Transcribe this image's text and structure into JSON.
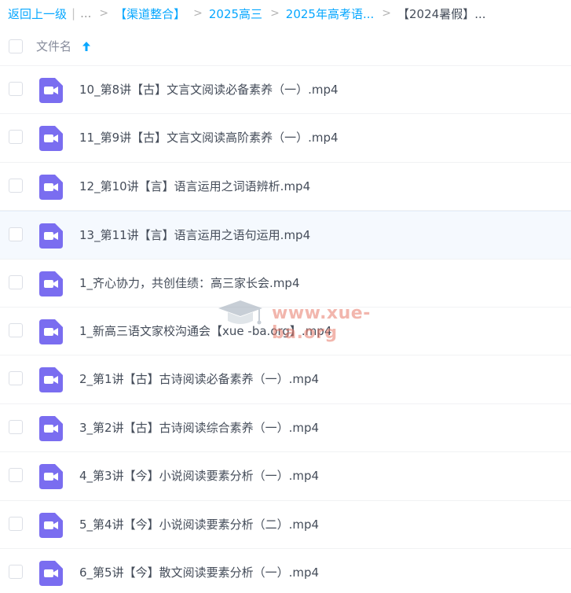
{
  "breadcrumb": {
    "back_label": "返回上一级",
    "separator": "|",
    "ellipsis": "...",
    "items": [
      "【渠道整合】",
      "2025高三",
      "2025年高考语...",
      "【2024暑假】..."
    ],
    "arrow": ">"
  },
  "header": {
    "column_label": "文件名",
    "sort_icon": "arrow-up-icon"
  },
  "files": [
    {
      "name": "10_第8讲【古】文言文阅读必备素养（一）.mp4",
      "icon": "video-file-icon"
    },
    {
      "name": "11_第9讲【古】文言文阅读高阶素养（一）.mp4",
      "icon": "video-file-icon"
    },
    {
      "name": "12_第10讲【言】语言运用之词语辨析.mp4",
      "icon": "video-file-icon"
    },
    {
      "name": "13_第11讲【言】语言运用之语句运用.mp4",
      "icon": "video-file-icon",
      "hovered": true
    },
    {
      "name": "1_齐心协力，共创佳绩：高三家长会.mp4",
      "icon": "video-file-icon"
    },
    {
      "name": "1_新高三语文家校沟通会【xue -ba.org】.mp4",
      "icon": "video-file-icon"
    },
    {
      "name": "2_第1讲【古】古诗阅读必备素养（一）.mp4",
      "icon": "video-file-icon"
    },
    {
      "name": "3_第2讲【古】古诗阅读综合素养（一）.mp4",
      "icon": "video-file-icon"
    },
    {
      "name": "4_第3讲【今】小说阅读要素分析（一）.mp4",
      "icon": "video-file-icon"
    },
    {
      "name": "5_第4讲【今】小说阅读要素分析（二）.mp4",
      "icon": "video-file-icon"
    },
    {
      "name": "6_第5讲【今】散文阅读要素分析（一）.mp4",
      "icon": "video-file-icon"
    }
  ],
  "watermark": {
    "text": "www.xue-ba.org",
    "icon": "graduation-cap-icon"
  },
  "colors": {
    "link": "#06a7ff",
    "icon_purple": "#7a6df0",
    "text": "#454d5a",
    "hover_row": "#f5f9fe"
  }
}
